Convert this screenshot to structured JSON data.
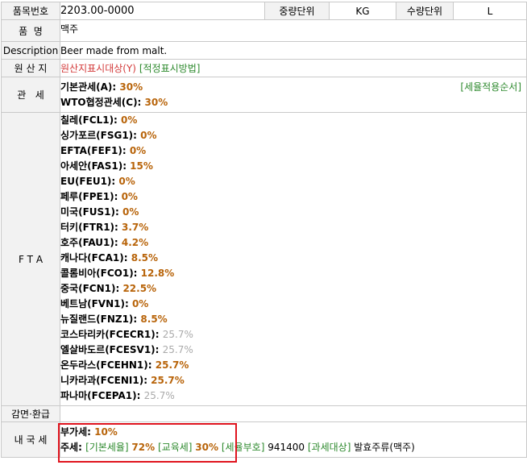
{
  "header": {
    "hs_label": "품목번호",
    "hs_code": "2203.00-0000",
    "weight_unit_label": "중량단위",
    "weight_unit_value": "KG",
    "qty_unit_label": "수량단위",
    "qty_unit_value": "L"
  },
  "name": {
    "label": "품  명",
    "value": "맥주"
  },
  "description": {
    "label": "Description",
    "value": "Beer made from malt."
  },
  "origin": {
    "label": "원 산 지",
    "mark": "원산지표시대상(Y)",
    "method_link": "[적정표시방법]"
  },
  "tariff": {
    "label": "관   세",
    "basic_label": "기본관세(A): ",
    "basic_rate": "30%",
    "wto_label": "WTO협정관세(C): ",
    "wto_rate": "30%",
    "order_link": "[세율적용순서]"
  },
  "fta": {
    "label": "F T A",
    "items": [
      {
        "name": "칠레(FCL1): ",
        "rate": "0%",
        "gray": false
      },
      {
        "name": "싱가포르(FSG1): ",
        "rate": "0%",
        "gray": false
      },
      {
        "name": "EFTA(FEF1): ",
        "rate": "0%",
        "gray": false
      },
      {
        "name": "아세안(FAS1): ",
        "rate": "15%",
        "gray": false
      },
      {
        "name": "EU(FEU1): ",
        "rate": "0%",
        "gray": false
      },
      {
        "name": "페루(FPE1): ",
        "rate": "0%",
        "gray": false
      },
      {
        "name": "미국(FUS1): ",
        "rate": "0%",
        "gray": false
      },
      {
        "name": "터키(FTR1): ",
        "rate": "3.7%",
        "gray": false
      },
      {
        "name": "호주(FAU1): ",
        "rate": "4.2%",
        "gray": false
      },
      {
        "name": "캐나다(FCA1): ",
        "rate": "8.5%",
        "gray": false
      },
      {
        "name": "콜롬비아(FCO1): ",
        "rate": "12.8%",
        "gray": false
      },
      {
        "name": "중국(FCN1): ",
        "rate": "22.5%",
        "gray": false
      },
      {
        "name": "베트남(FVN1): ",
        "rate": "0%",
        "gray": false
      },
      {
        "name": "뉴질랜드(FNZ1): ",
        "rate": "8.5%",
        "gray": false
      },
      {
        "name": "코스타리카(FCECR1): ",
        "rate": "25.7%",
        "gray": true
      },
      {
        "name": "엘살바도르(FCESV1): ",
        "rate": "25.7%",
        "gray": true
      },
      {
        "name": "온두라스(FCEHN1): ",
        "rate": "25.7%",
        "gray": false
      },
      {
        "name": "니카라과(FCENI1): ",
        "rate": "25.7%",
        "gray": false
      },
      {
        "name": "파나마(FCEPA1): ",
        "rate": "25.7%",
        "gray": true
      }
    ]
  },
  "reduction": {
    "label": "감면·환급"
  },
  "domestic": {
    "label": "내 국 세",
    "vat_label": "부가세: ",
    "vat_rate": "10%",
    "liquor_label": "주세: ",
    "basic_link": "[기본세율]",
    "basic_rate": "72%",
    "edu_link": "[교육세]",
    "edu_rate": "30%",
    "code_link": "[세율부호]",
    "code_value": "941400",
    "taxable_link": "[과세대상]",
    "taxable_value": "발효주류(맥주)"
  }
}
